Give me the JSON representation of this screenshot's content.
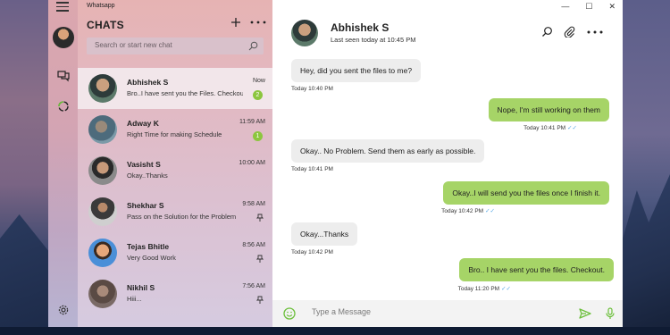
{
  "app": {
    "title": "Whatsapp"
  },
  "window_controls": [
    "—",
    "☐",
    "✕"
  ],
  "sidebar": {
    "header": "CHATS",
    "search_placeholder": "Search or start new chat"
  },
  "chats": [
    {
      "name": "Abhishek S",
      "preview": "Bro..I have sent you the Files. Checkout.",
      "time": "Now",
      "unread": "2",
      "active": true
    },
    {
      "name": "Adway K",
      "preview": "Right Time for making Schedule",
      "time": "11:59 AM",
      "unread": "1"
    },
    {
      "name": "Vasisht S",
      "preview": "Okay..Thanks",
      "time": "10:00 AM"
    },
    {
      "name": "Shekhar S",
      "preview": "Pass on the Solution for the Problem",
      "time": "9:58 AM",
      "pinned": true
    },
    {
      "name": "Tejas Bhitle",
      "preview": "Very Good Work",
      "time": "8:56 AM",
      "pinned": true
    },
    {
      "name": "Nikhil S",
      "preview": "Hiii...",
      "time": "7:56 AM",
      "pinned": true
    }
  ],
  "conversation": {
    "name": "Abhishek S",
    "status": "Last seen today at 10:45 PM",
    "messages": [
      {
        "dir": "in",
        "text": "Hey, did you sent the files to me?",
        "time": "Today 10:40 PM"
      },
      {
        "dir": "out",
        "text": "Nope, I'm still working on them",
        "time": "Today 10:41 PM",
        "tick": "✓✓"
      },
      {
        "dir": "in",
        "text": "Okay.. No Problem. Send them as early as possible.",
        "time": "Today 10:41 PM"
      },
      {
        "dir": "out",
        "text": "Okay..I will send you the files once I finish it.",
        "time": "Today 10:42 PM",
        "tick": "✓✓"
      },
      {
        "dir": "in",
        "text": "Okay...Thanks",
        "time": "Today 10:42 PM"
      },
      {
        "dir": "out",
        "text": "Bro.. I have sent you the files. Checkout.",
        "time": "Today 11:20 PM",
        "tick": "✓✓"
      }
    ],
    "compose_placeholder": "Type a Message"
  },
  "colors": {
    "accent": "#a6d467",
    "badge": "#8cc63f",
    "read_tick": "#5aa9e6"
  }
}
